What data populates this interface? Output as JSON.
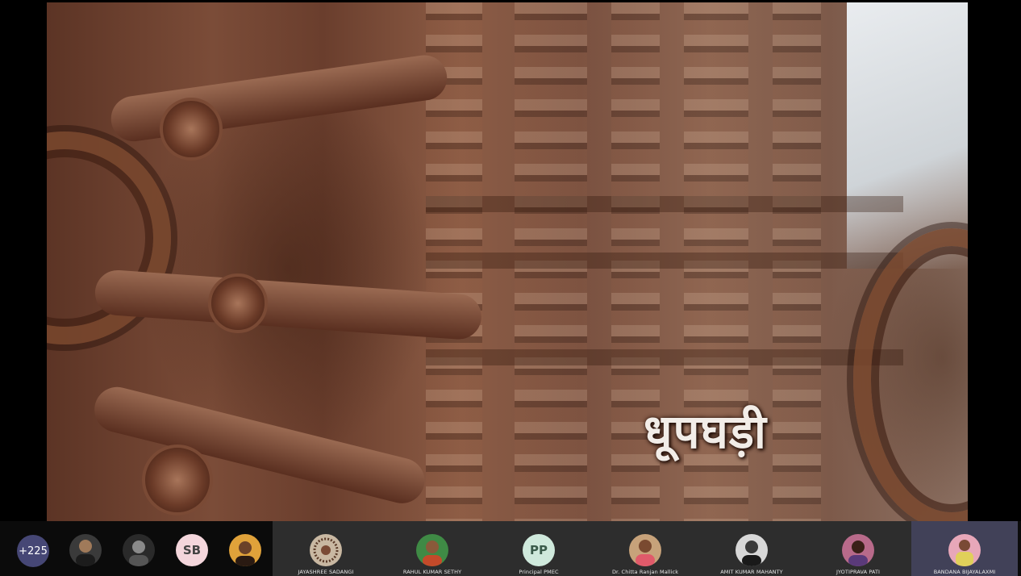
{
  "video": {
    "caption": "धूपघड़ी"
  },
  "participants": {
    "overflow_count": "+225",
    "mini": [
      {
        "initials": "",
        "icon": "person-photo-icon",
        "bg": "#3a3a3a"
      },
      {
        "initials": "",
        "icon": "person-photo-icon",
        "bg": "#2a2a2a"
      },
      {
        "initials": "SB",
        "icon": "initials-avatar",
        "bg": "#f4d6dc"
      },
      {
        "initials": "",
        "icon": "person-photo-icon",
        "bg": "#e0a23a"
      }
    ],
    "tiles": [
      {
        "name": "JAYASHREE SADANGI",
        "initials": "",
        "icon": "mandala-photo-icon",
        "bg": "#c9b8a2",
        "active": false
      },
      {
        "name": "RAHUL KUMAR SETHY",
        "initials": "",
        "icon": "person-photo-icon",
        "bg": "#3f8a45",
        "active": false
      },
      {
        "name": "Principal PMEC",
        "initials": "PP",
        "icon": "initials-avatar",
        "bg": "#cfe9dc",
        "active": false
      },
      {
        "name": "Dr. Chitta Ranjan Mallick",
        "initials": "",
        "icon": "person-photo-icon",
        "bg": "#c7a27a",
        "active": false
      },
      {
        "name": "AMIT KUMAR MAHANTY",
        "initials": "",
        "icon": "person-photo-icon",
        "bg": "#d8d8d8",
        "active": false
      },
      {
        "name": "JYOTIPRAVA PATI",
        "initials": "",
        "icon": "person-photo-icon",
        "bg": "#b86a8a",
        "active": false
      },
      {
        "name": "BANDANA BIJAYALAXMI",
        "initials": "",
        "icon": "person-photo-icon",
        "bg": "#e7a7b9",
        "active": true
      }
    ]
  }
}
